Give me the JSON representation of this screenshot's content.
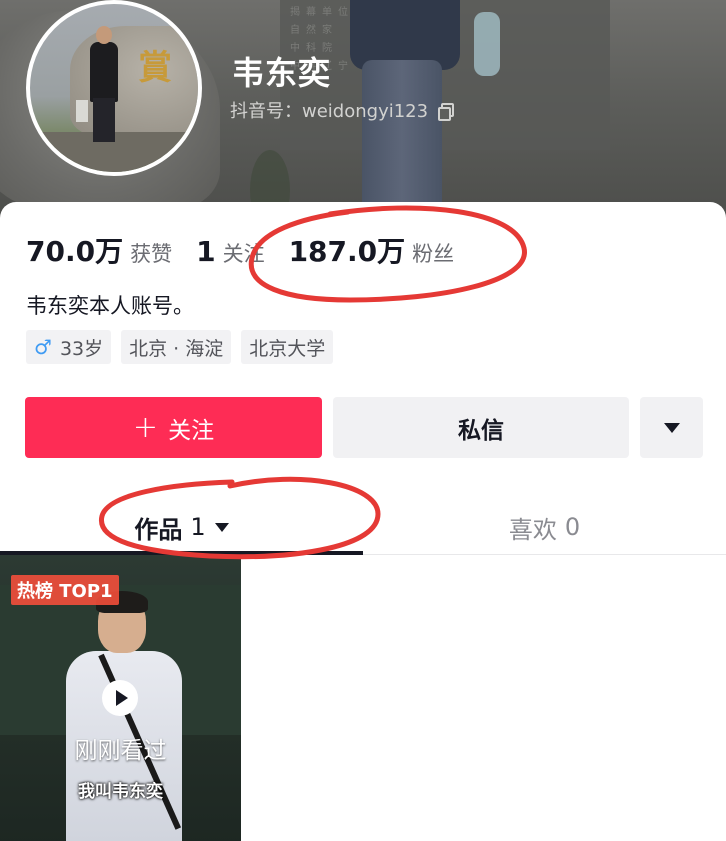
{
  "profile": {
    "name": "韦东奕",
    "douyin_id": "抖音号：weidongyi123"
  },
  "stats": {
    "likes_num": "70.0万",
    "likes_label": "获赞",
    "following_num": "1",
    "following_label": "关注",
    "followers_num": "187.0万",
    "followers_label": "粉丝"
  },
  "bio": "韦东奕本人账号。",
  "tags": {
    "age": "33岁",
    "location": "北京 · 海淀",
    "school": "北京大学"
  },
  "buttons": {
    "follow": "关注",
    "message": "私信"
  },
  "tabs": {
    "works_label": "作品",
    "works_count": "1",
    "likes_label": "喜欢",
    "likes_count": "0"
  },
  "video": {
    "badge": "热榜 TOP1",
    "seen": "刚刚看过",
    "subtitle": "我叫韦东奕"
  },
  "background_text": [
    "揭幕单位",
    "自然家",
    "中科院",
    "中科辽宁"
  ],
  "colors": {
    "accent": "#fe2c55",
    "annotation": "#e53935",
    "male": "#3f9bf3"
  },
  "icons": [
    "copy-icon",
    "male-icon",
    "plus-icon",
    "chevron-down-icon",
    "play-icon"
  ]
}
